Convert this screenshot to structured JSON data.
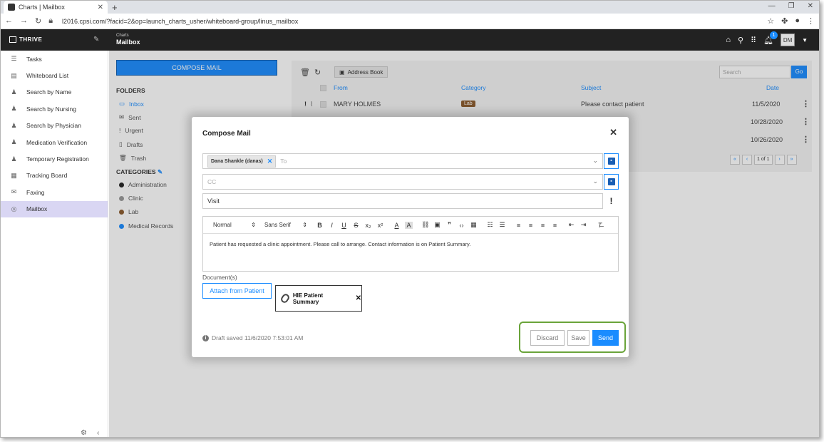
{
  "browser": {
    "tab_title": "Charts | Mailbox",
    "url": "l2016.cpsi.com/?facid=2&op=launch_charts_usher/whiteboard-group/linus_mailbox"
  },
  "app": {
    "brand": "THRIVE",
    "crumb_small": "Charts",
    "crumb_title": "Mailbox",
    "notification_count": "1",
    "user_initials": "DM"
  },
  "sidebar": {
    "items": [
      {
        "label": "Tasks",
        "icon": "tasks-icon"
      },
      {
        "label": "Whiteboard List",
        "icon": "whiteboard-icon"
      },
      {
        "label": "Search by Name",
        "icon": "person-search-icon"
      },
      {
        "label": "Search by Nursing",
        "icon": "nurse-search-icon"
      },
      {
        "label": "Search by Physician",
        "icon": "physician-search-icon"
      },
      {
        "label": "Medication Verification",
        "icon": "medication-icon"
      },
      {
        "label": "Temporary Registration",
        "icon": "registration-icon"
      },
      {
        "label": "Tracking Board",
        "icon": "tracking-board-icon"
      },
      {
        "label": "Faxing",
        "icon": "fax-icon"
      },
      {
        "label": "Mailbox",
        "icon": "mailbox-icon"
      }
    ]
  },
  "folders_panel": {
    "compose_label": "COMPOSE MAIL",
    "folders_heading": "FOLDERS",
    "folders": [
      "Inbox",
      "Sent",
      "Urgent",
      "Drafts",
      "Trash"
    ],
    "categories_heading": "CATEGORIES",
    "categories": [
      {
        "label": "Administration",
        "color": "#222222"
      },
      {
        "label": "Clinic",
        "color": "#999999"
      },
      {
        "label": "Lab",
        "color": "#8a5a2b"
      },
      {
        "label": "Medical Records",
        "color": "#1a8cff"
      }
    ]
  },
  "mailbox": {
    "address_book_label": "Address Book",
    "search_placeholder": "Search",
    "go_label": "Go",
    "columns": {
      "from": "From",
      "category": "Category",
      "subject": "Subject",
      "date": "Date"
    },
    "rows": [
      {
        "from": "MARY HOLMES",
        "category": "Lab",
        "subject": "Please contact patient",
        "date": "11/5/2020"
      },
      {
        "date": "10/28/2020"
      },
      {
        "date": "10/26/2020"
      }
    ],
    "pager": {
      "page": "1",
      "of": "of 1"
    }
  },
  "compose": {
    "title": "Compose Mail",
    "to_chip": "Dana Shankle (danas)",
    "to_placeholder": "To",
    "cc_placeholder": "CC",
    "subject": "Visit",
    "editor": {
      "format_select": "Normal",
      "font_select": "Sans Serif",
      "body": "Patient has requested a clinic appointment.  Please call to arrange.  Contact information is on Patient Summary."
    },
    "documents_label": "Document(s)",
    "attach_label": "Attach from Patient",
    "attachment_name": "HIE Patient Summary",
    "draft_status": "Draft saved 11/6/2020 7:53:01 AM",
    "discard_label": "Discard",
    "save_label": "Save",
    "send_label": "Send"
  },
  "colors": {
    "accent": "#1a8cff",
    "highlight_border": "#6aa43a",
    "active_sidebar": "#d9d6f3"
  }
}
